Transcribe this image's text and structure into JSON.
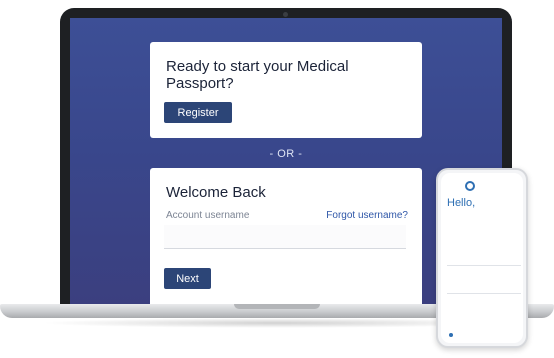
{
  "register_card": {
    "title": "Ready to start your Medical Passport?",
    "register_button": "Register"
  },
  "divider": {
    "text": "- OR -"
  },
  "login_card": {
    "title": "Welcome Back",
    "username_label": "Account username",
    "forgot_link": "Forgot username?",
    "username_value": "",
    "next_button": "Next"
  },
  "phone": {
    "logo_text": "",
    "greeting": "Hello,",
    "subtitle": "",
    "link_text": "",
    "field_label": "",
    "row_text_1": "",
    "row_text_2": "",
    "row_text_3": "",
    "foot_left": "",
    "foot_right": ""
  },
  "colors": {
    "screen_background": "#3b4a8e",
    "primary_button": "#2c4577",
    "link": "#2f57a8",
    "phone_accent": "#2e6fb3"
  }
}
